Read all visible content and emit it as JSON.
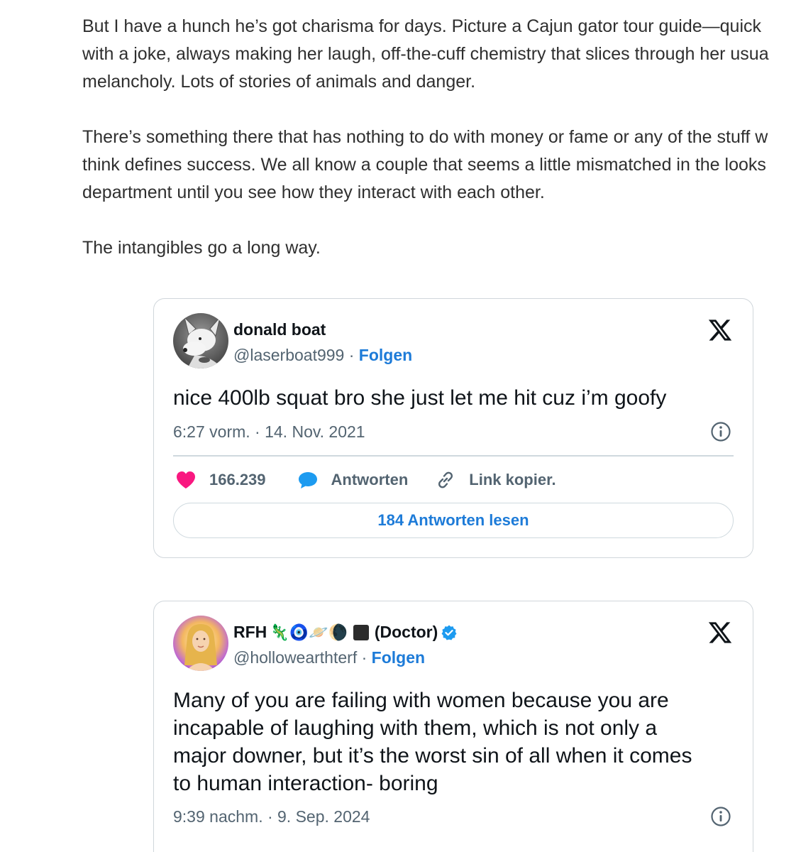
{
  "article": {
    "paragraphs": [
      {
        "lines": [
          "But I have a hunch he’s got charisma for days. Picture a Cajun gator tour guide—quick",
          "with a joke, always making her laugh, off-the-cuff chemistry that slices through her usua",
          "melancholy. Lots of stories of animals and danger."
        ]
      },
      {
        "lines": [
          "There’s something there that has nothing to do with money or fame or any of the stuff w",
          "think defines success. We all know a couple that seems a little mismatched in the looks",
          "department until you see how they interact with each other."
        ]
      },
      {
        "lines": [
          "The intangibles go a long way."
        ]
      }
    ]
  },
  "tweets": [
    {
      "name": "donald boat",
      "handle": "@laserboat999",
      "separator": "·",
      "follow_label": "Folgen",
      "text": "nice 400lb squat bro she just let me hit cuz i’m goofy",
      "timestamp": "6:27 vorm. · 14. Nov. 2021",
      "likes": "166.239",
      "reply_label": "Antworten",
      "copy_link_label": "Link kopier.",
      "read_replies_label": "184 Antworten lesen",
      "avatar_icon": "bull-terrier-avatar"
    },
    {
      "name_prefix": "RFH",
      "name_emojis": "🦎🧿🪐🌘",
      "name_suffix": "(Doctor)",
      "handle": "@hollowearthterf",
      "separator": "·",
      "follow_label": "Folgen",
      "text_lines": [
        "Many of you are failing with women because you are",
        "incapable of laughing with them, which is not only a",
        "major downer, but it’s the worst sin of all when it comes",
        "to human interaction- boring"
      ],
      "timestamp": "9:39 nachm. · 9. Sep. 2024",
      "verified": true,
      "avatar_icon": "glowing-woman-avatar"
    }
  ],
  "colors": {
    "accent_blue": "#1d7bd8",
    "like_pink": "#f91880",
    "reply_blue": "#1d9bf0",
    "text_dark": "#0f1419",
    "text_gray": "#536471",
    "border": "#cfd9de"
  }
}
